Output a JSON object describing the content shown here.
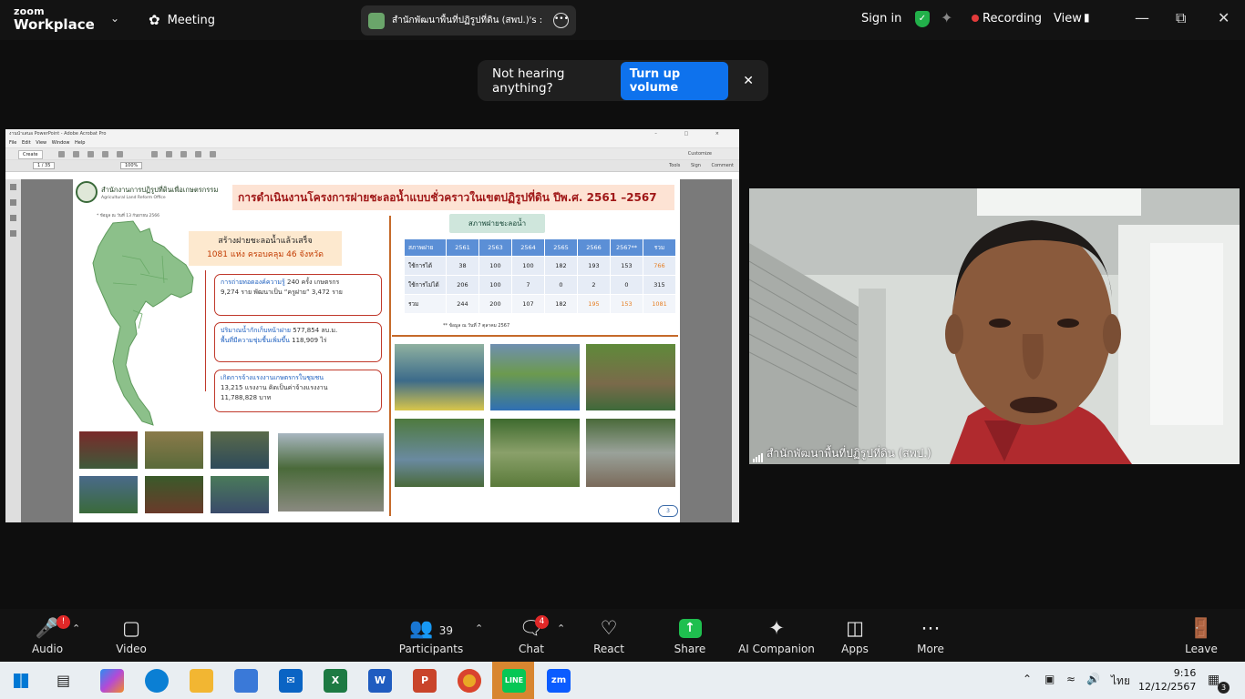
{
  "app": {
    "brand_line1": "zoom",
    "brand_line2": "Workplace",
    "menu_meeting": "Meeting",
    "share_pill_text": "สำนักพัฒนาพื้นที่ปฏิรูปที่ดิน (สพป.)'s :",
    "sign_in": "Sign in",
    "recording": "Recording",
    "view": "View"
  },
  "toast": {
    "message": "Not hearing anything?",
    "button": "Turn up volume"
  },
  "acrobat": {
    "window_title": "งานนำเสนอ PowerPoint - Adobe Acrobat Pro",
    "menus": [
      "File",
      "Edit",
      "View",
      "Window",
      "Help"
    ],
    "create": "Create",
    "customize": "Customize",
    "page_field": "1 / 35",
    "zoom": "100%",
    "right_tools": "Tools Sign Comment"
  },
  "slide": {
    "org_name": "สำนักงานการปฏิรูปที่ดินเพื่อเกษตรกรรม",
    "org_name_en": "Agricultural Land Reform Office",
    "as_of_left": "* ข้อมูล ณ วันที่ 13 กันยายน 2566",
    "title": "การดำเนินงานโครงการฝายชะลอน้ำแบบชั่วคราวในเขตปฏิรูปที่ดิน ปีพ.ศ. 2561 –2567",
    "headline_1": "สร้างฝายชะลอน้ำแล้วเสร็จ",
    "headline_2": "1081 แห่ง ครอบคลุม 46 จังหวัด",
    "box1_h": "การถ่ายทอดองค์ความรู้",
    "box1_t": " 240 ครั้ง เกษตรกร",
    "box1_t2": "9,274 ราย พัฒนาเป็น “ครูฝาย” 3,472 ราย",
    "box2_h": "ปริมาณน้ำกักเก็บหน้าฝาย",
    "box2_t": " 577,854 ลบ.ม.",
    "box2_h2": "พื้นที่มีความชุ่มชื้นเพิ่มขึ้น",
    "box2_t2": " 118,909 ไร่",
    "box3_h": "เกิดการจ้างแรงงานเกษตรกรในชุมชน",
    "box3_t": "13,215 แรงงาน คิดเป็นค่าจ้างแรงงาน",
    "box3_t2": "11,788,828 บาท",
    "weir_title": "สภาพฝายชะลอน้ำ",
    "table_headers": [
      "สภาพฝาย",
      "2561",
      "2563",
      "2564",
      "2565",
      "2566",
      "2567**",
      "รวม"
    ],
    "table_rows": [
      [
        "ใช้การได้",
        "38",
        "100",
        "100",
        "182",
        "193",
        "153",
        "766"
      ],
      [
        "ใช้การไม่ได้",
        "206",
        "100",
        "7",
        "0",
        "2",
        "0",
        "315"
      ],
      [
        "รวม",
        "244",
        "200",
        "107",
        "182",
        "195",
        "153",
        "1081"
      ]
    ],
    "as_of_right": "** ข้อมูล ณ วันที่ 7 ตุลาคม 2567",
    "page_number": "3"
  },
  "video": {
    "participant_name": "สำนักพัฒนาพื้นที่ปฏิรูปที่ดิน (สพป.)"
  },
  "toolbar": {
    "audio": "Audio",
    "audio_badge": "!",
    "video": "Video",
    "participants": "Participants",
    "participants_count": "39",
    "chat": "Chat",
    "chat_badge": "4",
    "react": "React",
    "share": "Share",
    "ai_companion": "AI Companion",
    "apps": "Apps",
    "more": "More",
    "leave": "Leave"
  },
  "taskbar": {
    "lang": "ไทย",
    "time": "9:16",
    "date": "12/12/2567",
    "notif_count": "3",
    "apps": [
      "Copilot",
      "Edge",
      "File Explorer",
      "Store",
      "Mail",
      "Excel",
      "Word",
      "PowerPoint",
      "Chrome",
      "LINE",
      "Zoom"
    ]
  },
  "colors": {
    "zoom_blue": "#0e72ed",
    "recording_red": "#e23b3b",
    "share_green": "#1fbf4f",
    "slide_title_red": "#a01818"
  }
}
